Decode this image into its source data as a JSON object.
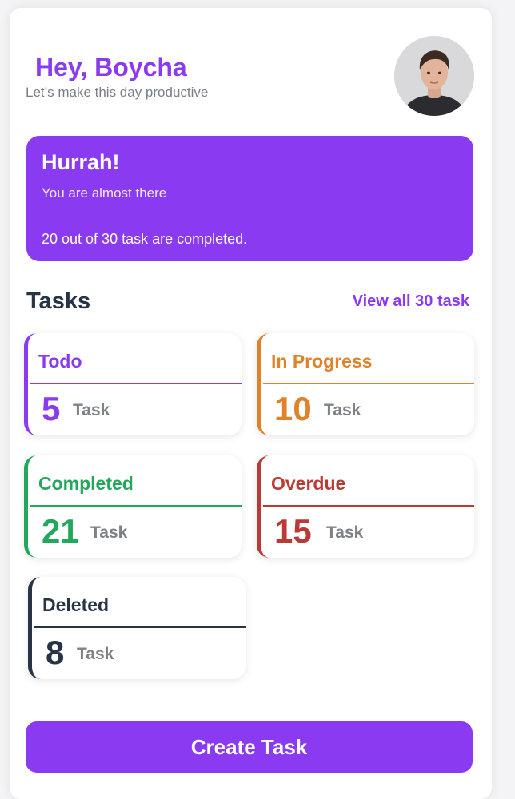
{
  "header": {
    "greeting": "Hey, Boycha",
    "subtitle": "Let’s make this day productive"
  },
  "banner": {
    "title": "Hurrah!",
    "subtitle": "You are almost there",
    "progress_text": "20 out of 30 task are completed."
  },
  "tasks": {
    "heading": "Tasks",
    "view_all": "View all 30 task",
    "cards": [
      {
        "title": "Todo",
        "count": "5",
        "unit": "Task",
        "color": "#8a3af0"
      },
      {
        "title": "In Progress",
        "count": "10",
        "unit": "Task",
        "color": "#e0822a"
      },
      {
        "title": "Completed",
        "count": "21",
        "unit": "Task",
        "color": "#22a85a"
      },
      {
        "title": "Overdue",
        "count": "15",
        "unit": "Task",
        "color": "#bb3a34"
      },
      {
        "title": "Deleted",
        "count": "8",
        "unit": "Task",
        "color": "#263445"
      }
    ]
  },
  "actions": {
    "create_task": "Create Task"
  },
  "colors": {
    "accent": "#8a3af0",
    "heading": "#263445",
    "muted": "#7a7f87"
  }
}
